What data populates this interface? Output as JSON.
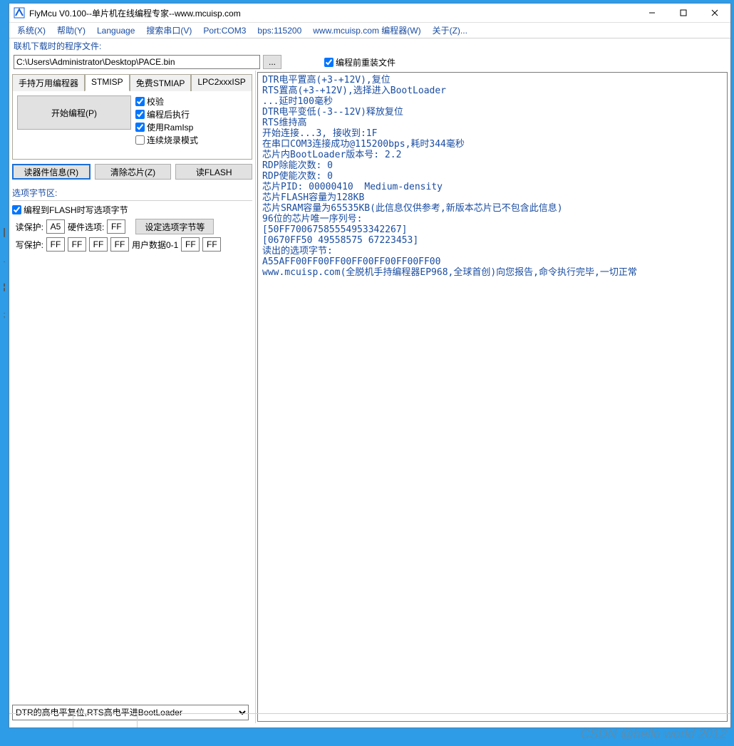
{
  "window": {
    "title": "FlyMcu V0.100--单片机在线编程专家--www.mcuisp.com"
  },
  "menu": {
    "items": [
      "系统(X)",
      "帮助(Y)",
      "Language",
      "搜索串口(V)",
      "Port:COM3",
      "bps:115200",
      "www.mcuisp.com 编程器(W)",
      "关于(Z)..."
    ]
  },
  "file": {
    "label": "联机下载时的程序文件:",
    "path": "C:\\Users\\Administrator\\Desktop\\PACE.bin",
    "browse": "...",
    "reload_cb": "编程前重装文件",
    "reload_checked": true
  },
  "tabs": {
    "items": [
      "手持万用编程器",
      "STMISP",
      "免费STMIAP",
      "LPC2xxxISP"
    ],
    "active": 1
  },
  "actions": {
    "start": "开始编程(P)",
    "checks": {
      "verify": "校验",
      "run_after": "编程后执行",
      "use_ramisp": "使用RamIsp",
      "continuous": "连续烧录模式"
    },
    "checks_state": {
      "verify": true,
      "run_after": true,
      "use_ramisp": true,
      "continuous": false
    },
    "read_info": "读器件信息(R)",
    "clear_chip": "清除芯片(Z)",
    "read_flash": "读FLASH"
  },
  "option": {
    "group": "选项字节区:",
    "write_opt_cb": "编程到FLASH时写选项字节",
    "write_opt_checked": true,
    "read_protect_label": "读保护:",
    "read_protect_val": "A5",
    "hw_opt_label": "硬件选项:",
    "hw_opt_val": "FF",
    "set_btn": "设定选项字节等",
    "write_protect_label": "写保护:",
    "wp": [
      "FF",
      "FF",
      "FF",
      "FF"
    ],
    "user_data_label": "用户数据0-1",
    "ud": [
      "FF",
      "FF"
    ]
  },
  "combo": {
    "value": "DTR的高电平复位,RTS高电平进BootLoader"
  },
  "log": "DTR电平置高(+3-+12V),复位\nRTS置高(+3-+12V),选择进入BootLoader\n...延时100毫秒\nDTR电平变低(-3--12V)释放复位\nRTS维持高\n开始连接...3, 接收到:1F\n在串口COM3连接成功@115200bps,耗时344毫秒\n芯片内BootLoader版本号: 2.2\nRDP除能次数: 0\nRDP使能次数: 0\n芯片PID: 00000410  Medium-density\n芯片FLASH容量为128KB\n芯片SRAM容量为65535KB(此信息仅供参考,新版本芯片已不包含此信息)\n96位的芯片唯一序列号:\n[50FF70067585554953342267]\n[0670FF50 49558575 67223453]\n读出的选项字节:\nA55AFF00FF00FF00FF00FF00FF00FF00\nwww.mcuisp.com(全脱机手持编程器EP968,全球首创)向您报告,命令执行完毕,一切正常",
  "watermark": "CSDN @hello world 2012"
}
